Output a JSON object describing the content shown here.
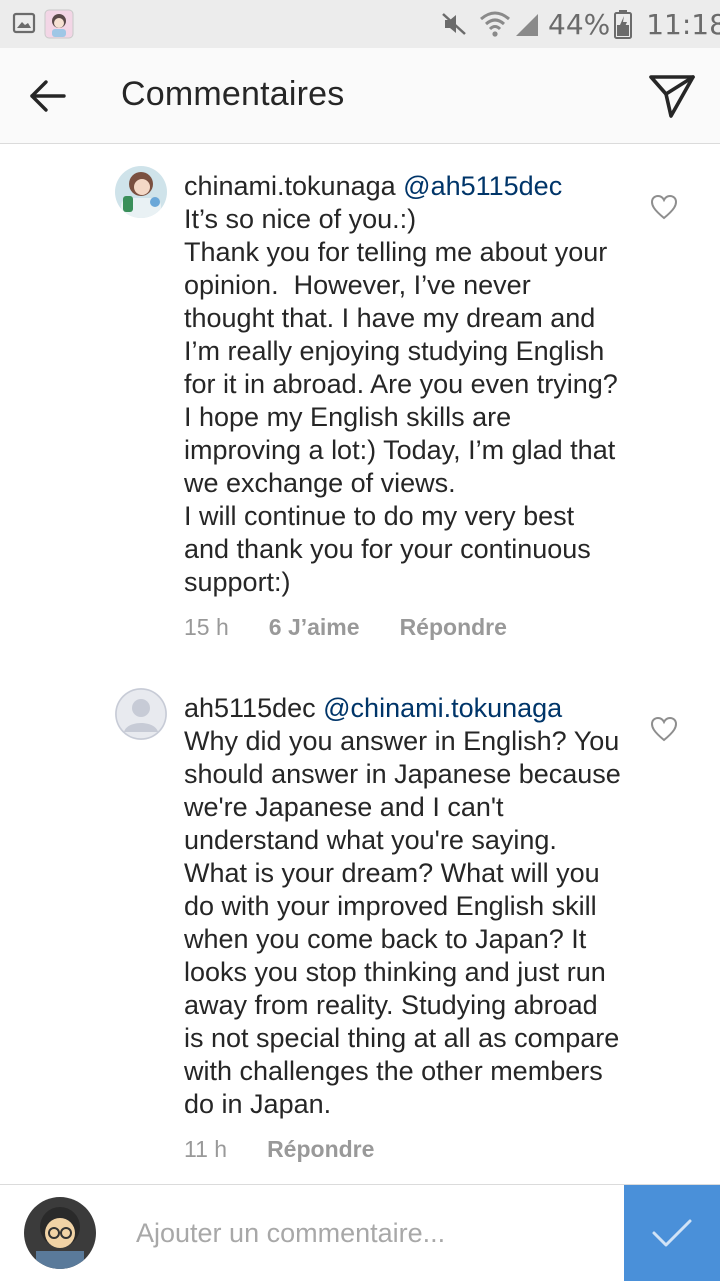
{
  "status_bar": {
    "battery": "44%",
    "time": "11:18",
    "icons": [
      "gallery-icon",
      "sticker-icon",
      "mute-icon",
      "wifi-icon",
      "signal-icon",
      "battery-icon"
    ]
  },
  "header": {
    "title": "Commentaires",
    "back_icon": "arrow-left-icon",
    "send_icon": "direct-send-icon"
  },
  "comments": [
    {
      "username": "chinami.tokunaga",
      "mention": "@ah5115dec",
      "text": "It’s so nice of you.:)\nThank you for telling me about your opinion.  However, I’ve never thought that. I have my dream and I’m really enjoying studying English for it in abroad. Are you even trying? I hope my English skills are improving a lot:) Today, I’m glad that we exchange of views.\nI will continue to do my very best and thank you for your continuous support:)",
      "time": "15 h",
      "likes": "6 J’aime",
      "reply": "Répondre"
    },
    {
      "username": "ah5115dec",
      "mention": "@chinami.tokunaga",
      "text": "Why did you answer in English? You should answer in Japanese because we're Japanese and I can't understand what you're saying. What is your dream? What will you do with your improved English skill when you come back to Japan? It looks you stop thinking and just run away from reality. Studying abroad is not special thing at all as compare with challenges the other members do in Japan.",
      "time": "11 h",
      "reply": "Répondre"
    }
  ],
  "composer": {
    "placeholder": "Ajouter un commentaire..."
  },
  "colors": {
    "mention": "#003569",
    "post_button": "#4a90d9",
    "muted": "#999999"
  }
}
